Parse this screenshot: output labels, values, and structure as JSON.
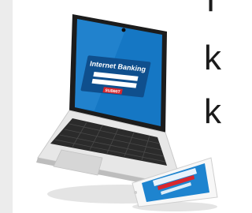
{
  "laptop_screen": {
    "heading": "Internet Banking",
    "submit_label": "SUBMIT"
  },
  "edge_text": {
    "line1": "T",
    "line2": "k",
    "line3": "k"
  },
  "colors": {
    "screen_blue": "#1577c4",
    "screen_dark": "#0f4f8d",
    "submit_red": "#d9262c",
    "phone_screen": "#1e84cf",
    "laptop_body": "#e7e7e7",
    "keyboard": "#2b2b2b"
  },
  "icons": {
    "laptop": "laptop-icon",
    "phone": "smartphone-icon"
  }
}
